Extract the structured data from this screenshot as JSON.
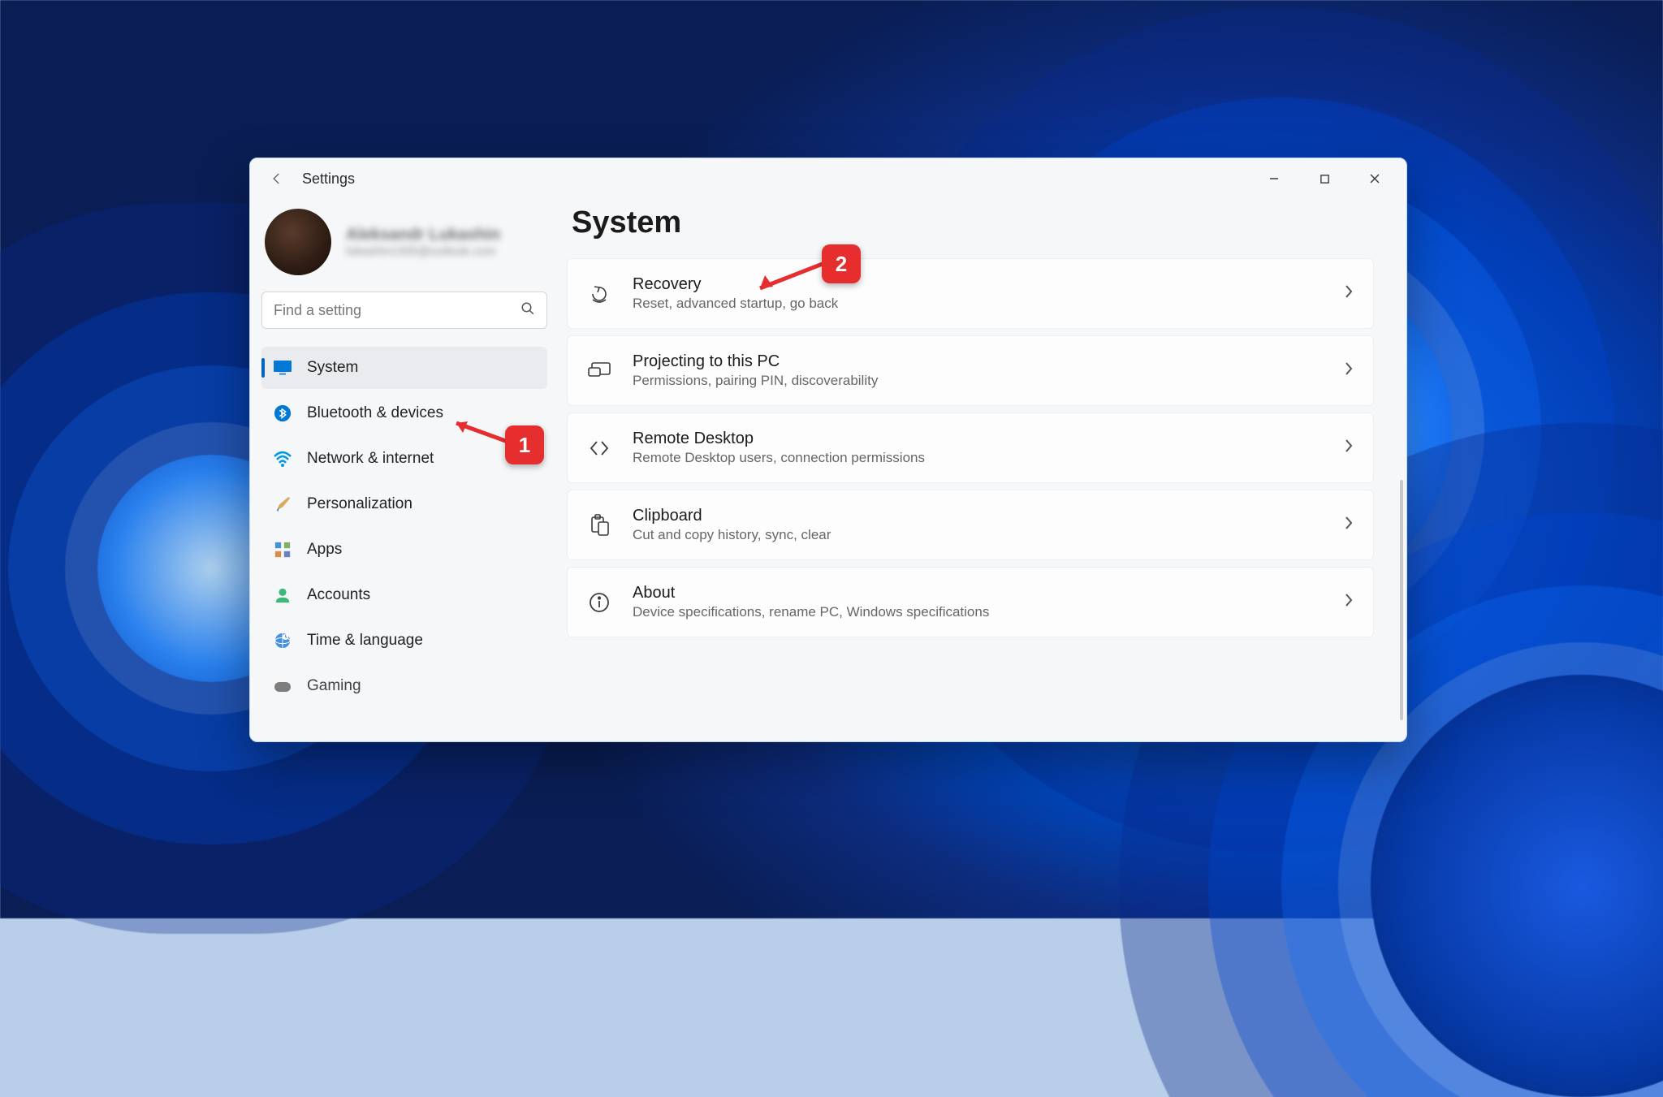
{
  "titlebar": {
    "title": "Settings"
  },
  "user": {
    "name": "Aleksandr Lukashin",
    "email": "lukashin1305@outlook.com"
  },
  "search": {
    "placeholder": "Find a setting"
  },
  "sidebar": {
    "items": [
      {
        "label": "System",
        "icon": "monitor-icon",
        "active": true
      },
      {
        "label": "Bluetooth & devices",
        "icon": "bluetooth-icon"
      },
      {
        "label": "Network & internet",
        "icon": "wifi-icon"
      },
      {
        "label": "Personalization",
        "icon": "brush-icon"
      },
      {
        "label": "Apps",
        "icon": "apps-icon"
      },
      {
        "label": "Accounts",
        "icon": "person-icon"
      },
      {
        "label": "Time & language",
        "icon": "globe-icon"
      },
      {
        "label": "Gaming",
        "icon": "gamepad-icon"
      }
    ]
  },
  "main": {
    "title": "System",
    "cards": [
      {
        "title": "Recovery",
        "desc": "Reset, advanced startup, go back",
        "icon": "recovery-icon"
      },
      {
        "title": "Projecting to this PC",
        "desc": "Permissions, pairing PIN, discoverability",
        "icon": "project-icon"
      },
      {
        "title": "Remote Desktop",
        "desc": "Remote Desktop users, connection permissions",
        "icon": "remote-icon"
      },
      {
        "title": "Clipboard",
        "desc": "Cut and copy history, sync, clear",
        "icon": "clipboard-icon"
      },
      {
        "title": "About",
        "desc": "Device specifications, rename PC, Windows specifications",
        "icon": "info-icon"
      }
    ]
  },
  "annotations": {
    "callout1": "1",
    "callout2": "2"
  }
}
